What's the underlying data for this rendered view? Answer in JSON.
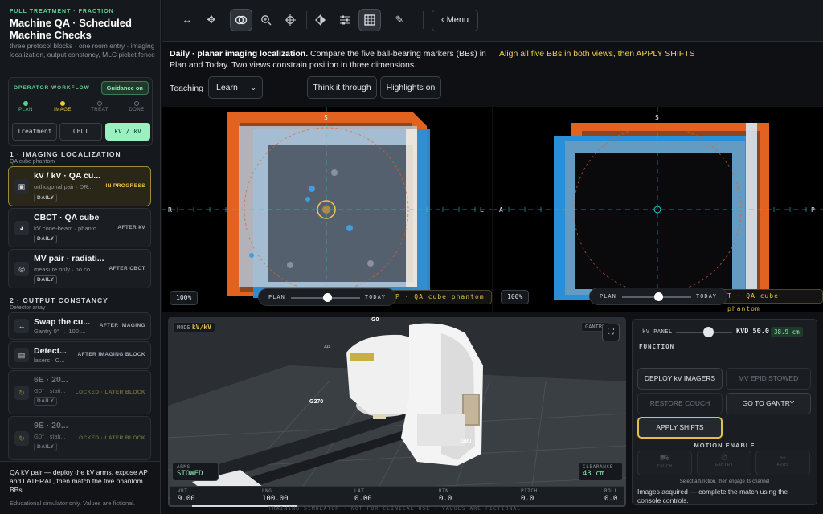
{
  "sidebar": {
    "kicker": "FULL TREATMENT · FRACTION",
    "title": "Machine QA · Scheduled Machine Checks",
    "subtitle": "three protocol blocks · one room entry · imaging localization, output constancy, MLC picket fence",
    "workflow": {
      "label": "OPERATOR WORKFLOW",
      "guidance": "Guidance on",
      "steps": [
        "PLAN",
        "IMAGE",
        "TREAT",
        "DONE"
      ],
      "modes": [
        "Treatment",
        "CBCT",
        "kV / kV"
      ]
    },
    "sections": [
      {
        "head": "1 · IMAGING LOCALIZATION",
        "sub": "QA cube phantom",
        "cards": [
          {
            "name": "kV / kV · QA cu...",
            "desc": "orthogonal pair · DR...",
            "status": "IN PROGRESS",
            "badge": "DAILY",
            "icon": "▣"
          },
          {
            "name": "CBCT · QA cube",
            "desc": "kV cone-beam · phanto...",
            "status": "AFTER kV",
            "badge": "DAILY",
            "icon": "◕"
          },
          {
            "name": "MV pair · radiati...",
            "desc": "measure only · no co...",
            "status": "AFTER CBCT",
            "badge": "DAILY",
            "icon": "◎"
          }
        ]
      },
      {
        "head": "2 · OUTPUT CONSTANCY",
        "sub": "Detector array",
        "cards": [
          {
            "name": "Swap the cu...",
            "desc": "Gantry 0° → 100 ...",
            "status": "AFTER IMAGING",
            "icon": "↔"
          },
          {
            "name": "Detect...",
            "desc": "lasers · O...",
            "status": "AFTER IMAGING BLOCK",
            "icon": "▤"
          },
          {
            "name": "6E · 20...",
            "desc": "G0° · stati...",
            "status": "LOCKED · LATER BLOCK",
            "badge": "DAILY",
            "icon": "↻"
          },
          {
            "name": "9E · 20...",
            "desc": "G0° · stati...",
            "status": "LOCKED · LATER BLOCK",
            "badge": "DAILY",
            "icon": "↻"
          }
        ]
      }
    ],
    "footer": {
      "message": "QA kV pair — deploy the kV arms, expose AP and LATERAL, then match the five phantom BBs.",
      "fine": "Educational simulator only. Values are fictional."
    }
  },
  "toolbar": {
    "menu": "‹ Menu"
  },
  "instructions": {
    "lead": "Daily · planar imaging localization.",
    "body": " Compare the five ball-bearing markers (BBs) in Plan and Today. Two views constrain position in three dimensions.",
    "goal": "Align all five BBs in both views, then APPLY SHIFTS",
    "teaching_label": "Teaching",
    "teaching_value": "Learn",
    "think_btn": "Think it through",
    "highlights_btn": "Highlights on"
  },
  "views": {
    "left": {
      "zoom": "100%",
      "top": "S",
      "left": "R",
      "right": "L",
      "plan": "PLAN",
      "today": "TODAY",
      "label": "P · QA cube phantom"
    },
    "right": {
      "zoom": "100%",
      "top": "S",
      "left": "A",
      "right": "P",
      "plan": "PLAN",
      "today": "TODAY",
      "label": "T · QA cube phantom"
    }
  },
  "room": {
    "mode_key": "MODE",
    "mode_val": "kV/kV",
    "gantry_key": "GANTRY",
    "arms_key": "ARMS",
    "arms_val": "STOWED",
    "clearance_key": "CLEARANCE",
    "clearance_val": "43 cm",
    "g0": "G0",
    "g270": "G270",
    "g90": "G90",
    "g315": "315",
    "readouts": [
      {
        "k": "VRT",
        "v": "9.00"
      },
      {
        "k": "LNG",
        "v": "100.00"
      },
      {
        "k": "LAT",
        "v": "0.00"
      },
      {
        "k": "RTN",
        "v": "0.0"
      },
      {
        "k": "PITCH",
        "v": "0.0"
      },
      {
        "k": "ROLL",
        "v": "0.0"
      }
    ],
    "footer": "TRAINING SIMULATOR · NOT FOR CLINICAL USE · VALUES ARE FICTIONAL"
  },
  "console": {
    "kv_panel": "kV PANEL",
    "kvd": "KVD 50.0",
    "distance": "38.9 cm",
    "function": "FUNCTION",
    "buttons": {
      "deploy": "DEPLOY kV IMAGERS",
      "mv_epid": "MV EPID STOWED",
      "restore": "RESTORE COUCH",
      "gantry": "GO TO GANTRY",
      "apply": "APPLY SHIFTS"
    },
    "motion_enable": "MOTION ENABLE",
    "motion": [
      "COUCH",
      "GANTRY",
      "ARMS"
    ],
    "hint": "Select a function, then engage its channel",
    "status": "Images acquired — complete the match using the console controls."
  },
  "colors": {
    "accent": "#5ccf8e",
    "warning": "#f0c64a",
    "plan": "#e2621f",
    "today": "#2a8fd6"
  }
}
